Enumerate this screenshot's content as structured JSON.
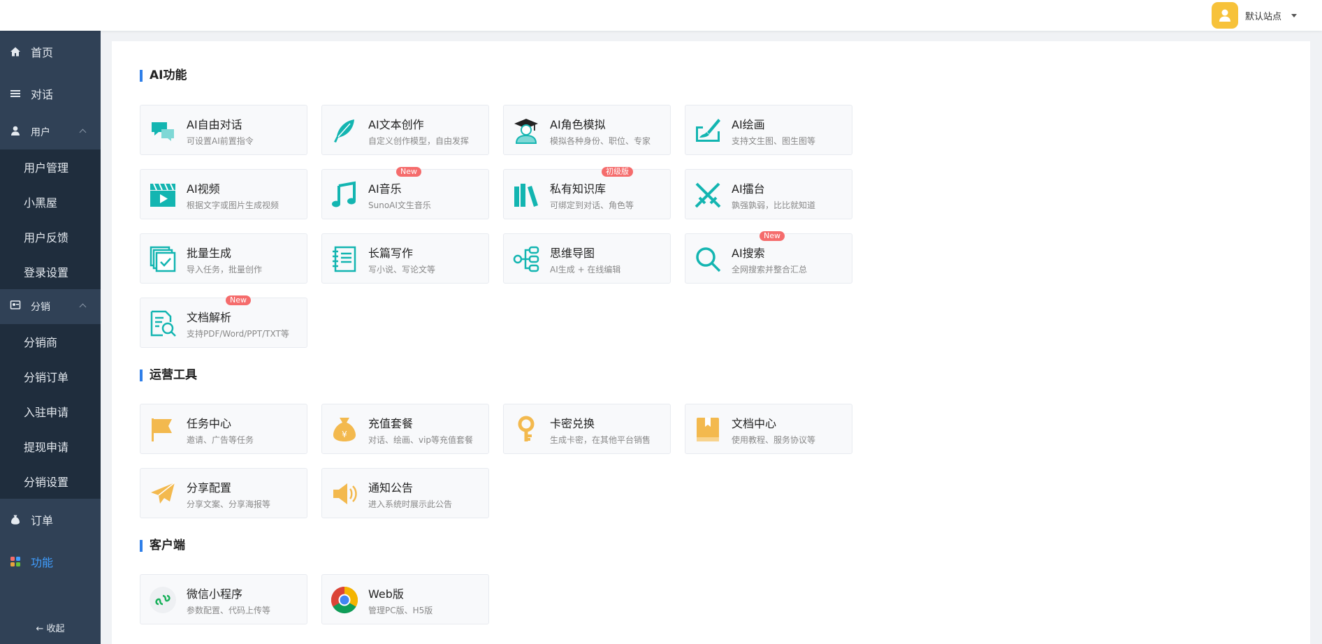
{
  "header": {
    "site_name": "默认站点"
  },
  "sidebar": {
    "home": "首页",
    "chat": "对话",
    "user_group": "用户",
    "user_items": [
      "用户管理",
      "小黑屋",
      "用户反馈",
      "登录设置"
    ],
    "dist_group": "分销",
    "dist_items": [
      "分销商",
      "分销订单",
      "入驻申请",
      "提现申请",
      "分销设置"
    ],
    "orders": "订单",
    "features": "功能",
    "collapse": "收起",
    "active_color": "#409eff"
  },
  "sections": {
    "ai": {
      "title": "AI功能",
      "cards": [
        {
          "title": "AI自由对话",
          "desc": "可设置AI前置指令",
          "icon": "chat-bubbles-icon"
        },
        {
          "title": "AI文本创作",
          "desc": "自定义创作模型，自由发挥",
          "icon": "feather-icon"
        },
        {
          "title": "AI角色模拟",
          "desc": "模拟各种身份、职位、专家",
          "icon": "graduate-icon"
        },
        {
          "title": "AI绘画",
          "desc": "支持文生图、图生图等",
          "icon": "paint-icon"
        },
        {
          "title": "AI视频",
          "desc": "根据文字或图片生成视频",
          "icon": "video-icon"
        },
        {
          "title": "AI音乐",
          "desc": "SunoAI文生音乐",
          "icon": "music-icon",
          "badge": "New"
        },
        {
          "title": "私有知识库",
          "desc": "可绑定到对话、角色等",
          "icon": "books-icon",
          "badge": "初级版"
        },
        {
          "title": "AI擂台",
          "desc": "孰强孰弱，比比就知道",
          "icon": "swords-icon"
        },
        {
          "title": "批量生成",
          "desc": "导入任务，批量创作",
          "icon": "batch-icon"
        },
        {
          "title": "长篇写作",
          "desc": "写小说、写论文等",
          "icon": "notebook-icon"
        },
        {
          "title": "思维导图",
          "desc": "AI生成 + 在线编辑",
          "icon": "mindmap-icon"
        },
        {
          "title": "AI搜索",
          "desc": "全网搜索并整合汇总",
          "icon": "search-icon",
          "badge": "New"
        },
        {
          "title": "文档解析",
          "desc": "支持PDF/Word/PPT/TXT等",
          "icon": "doc-parse-icon",
          "badge": "New"
        }
      ]
    },
    "ops": {
      "title": "运营工具",
      "cards": [
        {
          "title": "任务中心",
          "desc": "邀请、广告等任务",
          "icon": "flag-icon"
        },
        {
          "title": "充值套餐",
          "desc": "对话、绘画、vip等充值套餐",
          "icon": "moneybag-icon"
        },
        {
          "title": "卡密兑换",
          "desc": "生成卡密，在其他平台销售",
          "icon": "key-icon"
        },
        {
          "title": "文档中心",
          "desc": "使用教程、服务协议等",
          "icon": "book-icon"
        },
        {
          "title": "分享配置",
          "desc": "分享文案、分享海报等",
          "icon": "paper-plane-icon"
        },
        {
          "title": "通知公告",
          "desc": "进入系统时展示此公告",
          "icon": "speaker-icon"
        }
      ]
    },
    "client": {
      "title": "客户端",
      "cards": [
        {
          "title": "微信小程序",
          "desc": "参数配置、代码上传等",
          "icon": "miniprogram-icon"
        },
        {
          "title": "Web版",
          "desc": "管理PC版、H5版",
          "icon": "chrome-icon"
        }
      ]
    }
  },
  "colors": {
    "ai_icon": "#13b5b1",
    "ops_icon": "#f3b94e",
    "badge": "#f56c6c",
    "section_bar": "#2f7fe9"
  }
}
